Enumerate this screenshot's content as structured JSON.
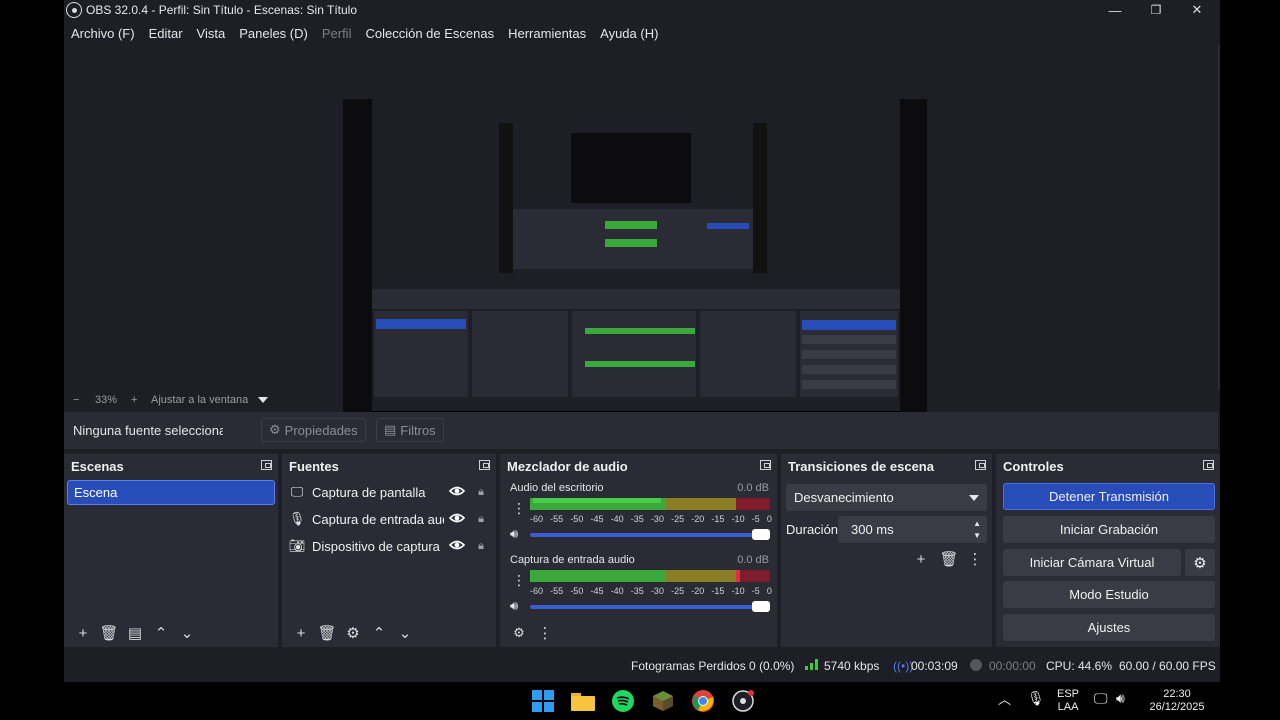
{
  "window": {
    "title": "OBS 32.0.4 - Perfil: Sin Título - Escenas: Sin Título",
    "controls": {
      "minimize": "—",
      "maximize": "❐",
      "close": "✕"
    }
  },
  "menu": [
    "Archivo (F)",
    "Editar",
    "Vista",
    "Paneles (D)",
    "Perfil",
    "Colección de Escenas",
    "Herramientas",
    "Ayuda (H)"
  ],
  "zoom": {
    "minus": "−",
    "value": "33%",
    "plus": "+",
    "fit_label": "Ajustar a la ventana"
  },
  "properties_bar": {
    "no_selection": "Ninguna fuente seleccionada",
    "properties": "Propiedades",
    "filters": "Filtros"
  },
  "scenes": {
    "title": "Escenas",
    "items": [
      "Escena"
    ]
  },
  "sources": {
    "title": "Fuentes",
    "items": [
      {
        "icon": "monitor-icon",
        "name": "Captura de pantalla"
      },
      {
        "icon": "microphone-icon",
        "name": "Captura de entrada audio"
      },
      {
        "icon": "camera-icon",
        "name": "Dispositivo de captura de video"
      }
    ]
  },
  "mixer": {
    "title": "Mezclador de audio",
    "channels": [
      {
        "name": "Audio del escritorio",
        "db": "0.0 dB"
      },
      {
        "name": "Captura de entrada audio",
        "db": "0.0 dB"
      }
    ],
    "ticks": [
      "-60",
      "-55",
      "-50",
      "-45",
      "-40",
      "-35",
      "-30",
      "-25",
      "-20",
      "-15",
      "-10",
      "-5",
      "0"
    ]
  },
  "transitions": {
    "title": "Transiciones de escena",
    "selected": "Desvanecimiento",
    "duration_label": "Duración",
    "duration_value": "300 ms"
  },
  "controls": {
    "title": "Controles",
    "stop_stream": "Detener Transmisión",
    "start_recording": "Iniciar Grabación",
    "start_virtual_cam": "Iniciar Cámara Virtual",
    "studio_mode": "Modo Estudio",
    "settings": "Ajustes"
  },
  "status": {
    "dropped_frames": "Fotogramas Perdidos 0 (0.0%)",
    "bitrate": "5740 kbps",
    "stream_time": "00:03:09",
    "record_time": "00:00:00",
    "cpu": "CPU: 44.6%",
    "fps": "60.00 / 60.00 FPS"
  },
  "taskbar": {
    "lang_top": "ESP",
    "lang_bottom": "LAA",
    "time": "22:30",
    "date": "26/12/2025"
  },
  "colors": {
    "accent": "#284cb8",
    "meter_green": "#3aa83a",
    "meter_yellow": "#b0a12a",
    "meter_red": "#b0283c"
  }
}
